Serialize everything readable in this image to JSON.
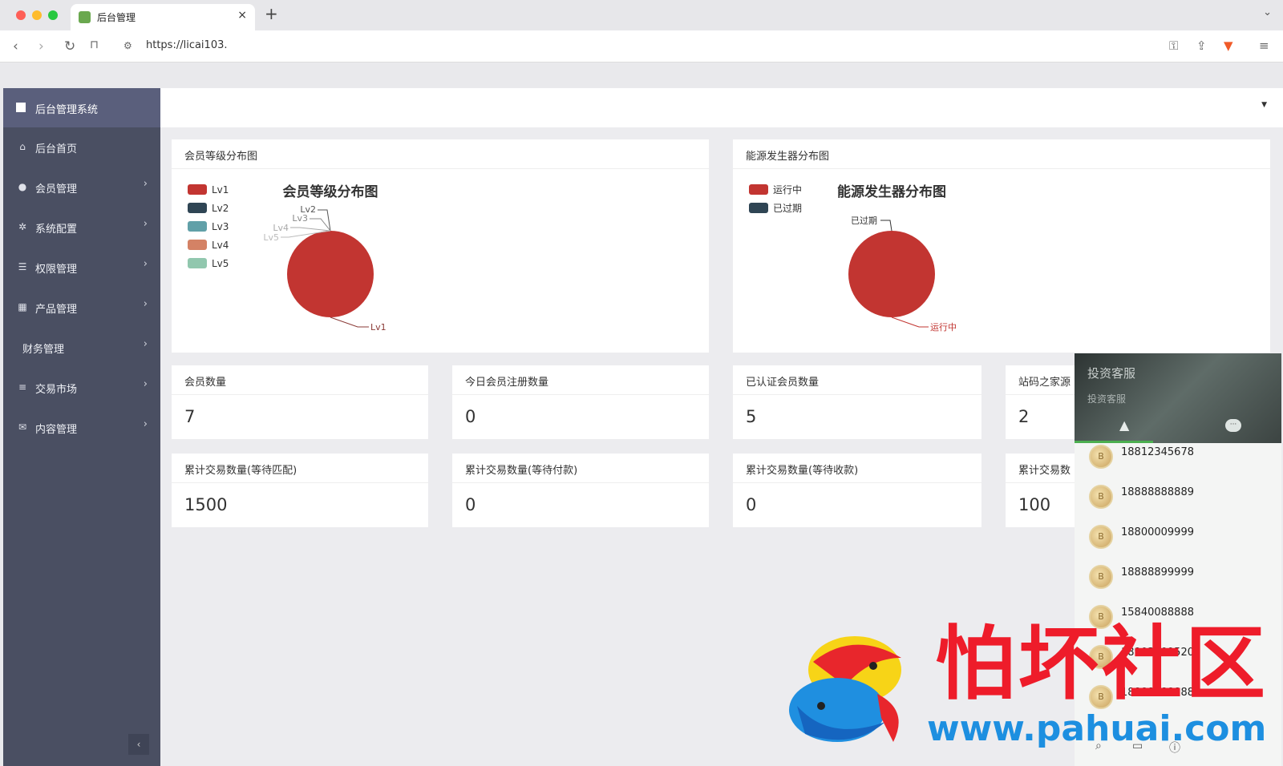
{
  "browser": {
    "tab_title": "后台管理",
    "tab_close": "×",
    "new_tab": "+",
    "tabs_menu": "⌄",
    "back": "‹",
    "forward": "›",
    "reload": "↻",
    "bookmark": "⊓",
    "url": "https://licai103.",
    "site_info_icon": "⚙",
    "key_icon": "⚿",
    "share_icon": "⇪",
    "shield_icon": "▼",
    "menu_icon": "≡"
  },
  "sidebar": {
    "title": "后台管理系统",
    "items": [
      {
        "label": "后台首页",
        "icon": "home-icon",
        "glyph": "⌂",
        "arrow": ""
      },
      {
        "label": "会员管理",
        "icon": "user-icon",
        "glyph": "●",
        "arrow": "›"
      },
      {
        "label": "系统配置",
        "icon": "gears-icon",
        "glyph": "✲",
        "arrow": "›"
      },
      {
        "label": "权限管理",
        "icon": "list-icon",
        "glyph": "☰",
        "arrow": "›"
      },
      {
        "label": "产品管理",
        "icon": "windows-icon",
        "glyph": "▦",
        "arrow": "›"
      },
      {
        "label": "财务管理",
        "icon": "",
        "glyph": "",
        "arrow": "›"
      },
      {
        "label": "交易市场",
        "icon": "menu-icon",
        "glyph": "≡",
        "arrow": "›"
      },
      {
        "label": "内容管理",
        "icon": "envelope-icon",
        "glyph": "✉",
        "arrow": "›"
      }
    ],
    "collapse": "‹"
  },
  "topbar": {
    "caret": "▼"
  },
  "panels": {
    "member_level": {
      "title": "会员等级分布图",
      "chart_data": {
        "type": "pie",
        "title": "会员等级分布图",
        "categories": [
          "Lv1",
          "Lv2",
          "Lv3",
          "Lv4",
          "Lv5"
        ],
        "values": [
          7,
          0,
          0,
          0,
          0
        ],
        "colors": [
          "#c23531",
          "#2f4554",
          "#61a0a8",
          "#d48265",
          "#91c7ae"
        ],
        "legend_position": "top-left"
      }
    },
    "generator": {
      "title": "能源发生器分布图",
      "chart_data": {
        "type": "pie",
        "title": "能源发生器分布图",
        "categories": [
          "运行中",
          "已过期"
        ],
        "values": [
          1,
          0
        ],
        "colors": [
          "#c23531",
          "#2f4554"
        ],
        "legend_position": "top-left"
      }
    }
  },
  "stats": [
    {
      "title": "会员数量",
      "value": "7"
    },
    {
      "title": "今日会员注册数量",
      "value": "0"
    },
    {
      "title": "已认证会员数量",
      "value": "5"
    },
    {
      "title": "站码之家源",
      "value": "2"
    },
    {
      "title": "累计交易数量(等待匹配)",
      "value": "1500"
    },
    {
      "title": "累计交易数量(等待付款)",
      "value": "0"
    },
    {
      "title": "累计交易数量(等待收款)",
      "value": "0"
    },
    {
      "title": "累计交易数",
      "value": "100"
    }
  ],
  "customer_service": {
    "title": "投资客服",
    "subtitle": "投资客服",
    "tab_person_icon": "▲",
    "tab_chat_icon": "···",
    "avatar_glyph": "B",
    "contacts": [
      "18812345678",
      "18888888889",
      "18800009999",
      "18888899999",
      "15840088888",
      "18903309520",
      "18888888888"
    ],
    "bottom_icons": [
      "⌕",
      "▭",
      "ⓘ"
    ]
  },
  "watermark": {
    "text": "怕坏社区",
    "url": "www.pahuai.com"
  }
}
